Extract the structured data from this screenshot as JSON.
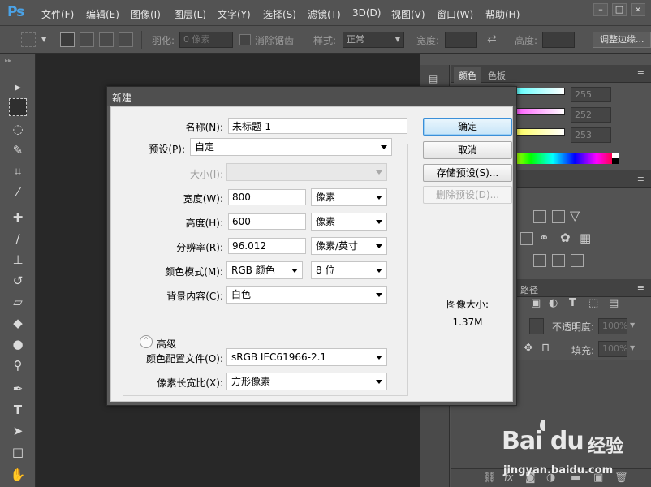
{
  "app": {
    "logo": "Ps"
  },
  "menu": [
    "文件(F)",
    "编辑(E)",
    "图像(I)",
    "图层(L)",
    "文字(Y)",
    "选择(S)",
    "滤镜(T)",
    "3D(D)",
    "视图(V)",
    "窗口(W)",
    "帮助(H)"
  ],
  "window_buttons": {
    "minimize": "–",
    "restore": "□",
    "close": "×"
  },
  "options": {
    "feather_label": "羽化:",
    "feather_value": "0 像素",
    "antialias_label": "消除锯齿",
    "style_label": "样式:",
    "style_value": "正常",
    "width_label": "宽度:",
    "height_label": "高度:",
    "refine_button": "调整边缘..."
  },
  "panels": {
    "tab_color": "颜色",
    "tab_swatches": "色板",
    "r_value": "255",
    "g_value": "252",
    "b_value": "253",
    "tab_paths": "路径",
    "opacity_label": "不透明度:",
    "opacity_value": "100%",
    "fill_label": "填充:",
    "fill_value": "100%"
  },
  "dialog": {
    "title": "新建",
    "name_label": "名称(N):",
    "name_value": "未标题-1",
    "preset_label": "预设(P):",
    "preset_value": "自定",
    "size_label": "大小(I):",
    "width_label": "宽度(W):",
    "width_value": "800",
    "width_unit": "像素",
    "height_label": "高度(H):",
    "height_value": "600",
    "height_unit": "像素",
    "resolution_label": "分辨率(R):",
    "resolution_value": "96.012",
    "resolution_unit": "像素/英寸",
    "color_mode_label": "颜色模式(M):",
    "color_mode_value": "RGB 颜色",
    "bit_depth_value": "8 位",
    "background_label": "背景内容(C):",
    "background_value": "白色",
    "advanced_label": "高级",
    "color_profile_label": "颜色配置文件(O):",
    "color_profile_value": "sRGB IEC61966-2.1",
    "pixel_aspect_label": "像素长宽比(X):",
    "pixel_aspect_value": "方形像素",
    "ok_button": "确定",
    "cancel_button": "取消",
    "save_preset_button": "存储预设(S)...",
    "delete_preset_button": "删除预设(D)...",
    "image_size_label": "图像大小:",
    "image_size_value": "1.37M"
  },
  "watermark": {
    "brand": "Bai du",
    "product": "经验",
    "url": "jingyan.baidu.com"
  }
}
